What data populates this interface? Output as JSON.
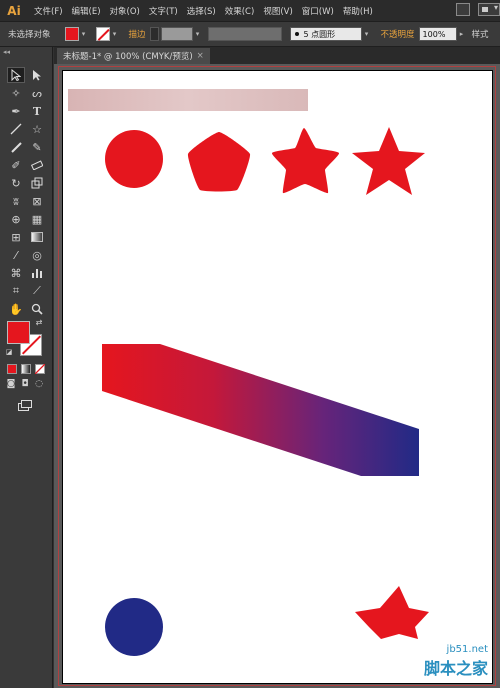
{
  "app": {
    "logo": "Ai"
  },
  "menu": [
    "文件(F)",
    "编辑(E)",
    "对象(O)",
    "文字(T)",
    "选择(S)",
    "效果(C)",
    "视图(V)",
    "窗口(W)",
    "帮助(H)"
  ],
  "control_bar": {
    "selection_label": "未选择对象",
    "stroke_label": "描边",
    "brush_value": "5 点圆形",
    "opacity_label": "不透明度",
    "opacity_value": "100%",
    "style_label": "样式"
  },
  "document_tab": {
    "title": "未标题-1* @ 100% (CMYK/预览)",
    "close": "×"
  },
  "colors": {
    "fill": "#e5161e",
    "shape_red": "#e5161e",
    "shape_blue": "#212a86",
    "gradient_start": "#e5161e",
    "gradient_end": "#212a86"
  },
  "watermark": {
    "site": "jb51.net",
    "name": "脚本之家"
  }
}
